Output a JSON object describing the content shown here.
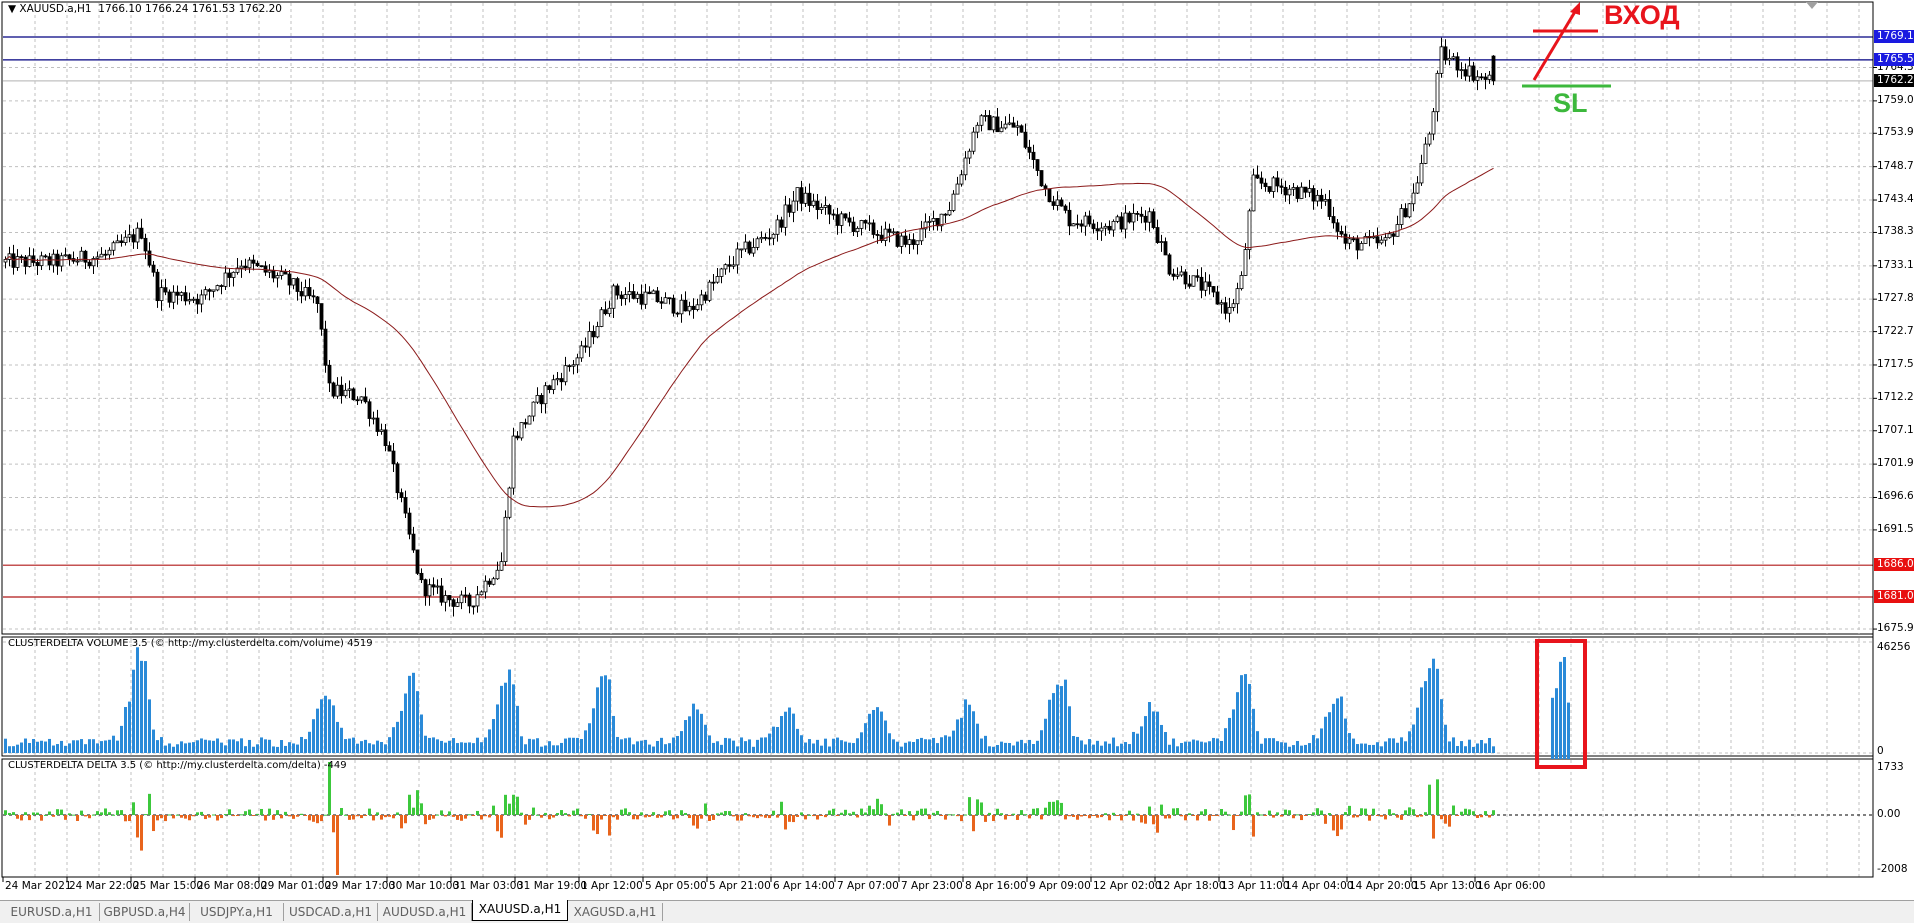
{
  "header": {
    "symbol": "XAUUSD.a,H1",
    "ohlc": "1766.10 1766.24 1761.53 1762.20"
  },
  "price_axis": {
    "ticks": [
      "1764.30",
      "1759.05",
      "1753.95",
      "1748.70",
      "1743.45",
      "1738.35",
      "1733.10",
      "1727.85",
      "1722.75",
      "1717.50",
      "1712.25",
      "1707.15",
      "1701.90",
      "1696.65",
      "1691.55",
      "1675.95"
    ],
    "tags": [
      {
        "label": "1769.10",
        "color": "#1a1ae0",
        "line": "#000080"
      },
      {
        "label": "1765.50",
        "color": "#1a1ae0",
        "line": "#000080"
      },
      {
        "label": "1762.20",
        "color": "#000000",
        "line": "#c0c0c0"
      },
      {
        "label": "1686.00",
        "color": "#e81010",
        "line": "#b01818"
      },
      {
        "label": "1681.00",
        "color": "#e81010",
        "line": "#b01818"
      }
    ]
  },
  "volume_pane": {
    "label": "CLUSTERDELTA VOLUME 3.5 (© http://my.clusterdelta.com/volume) 4519",
    "max": "46256",
    "min": "0",
    "color": "#2a8ad8",
    "peaks": [
      [
        34,
        40000
      ],
      [
        81,
        25000
      ],
      [
        102,
        30000
      ],
      [
        126,
        33000
      ],
      [
        150,
        30000
      ],
      [
        173,
        17000
      ],
      [
        196,
        16000
      ],
      [
        218,
        18000
      ],
      [
        241,
        21000
      ],
      [
        264,
        30000
      ],
      [
        287,
        17000
      ],
      [
        310,
        31000
      ],
      [
        333,
        21000
      ],
      [
        357,
        44000
      ]
    ],
    "highlighted_bars": [
      23000,
      27000,
      38000,
      40000,
      21000
    ]
  },
  "delta_pane": {
    "label": "CLUSTERDELTA DELTA 3.5 (© http://my.clusterdelta.com/delta) -449",
    "max": "1733",
    "zero": "0.00",
    "min": "-2008",
    "pos_color": "#3cc83c",
    "neg_color": "#e8641c"
  },
  "time_axis": [
    "24 Mar 2021",
    "24 Mar 22:00",
    "25 Mar 15:00",
    "26 Mar 08:00",
    "29 Mar 01:00",
    "29 Mar 17:00",
    "30 Mar 10:00",
    "31 Mar 03:00",
    "31 Mar 19:00",
    "1 Apr 12:00",
    "5 Apr 05:00",
    "5 Apr 21:00",
    "6 Apr 14:00",
    "7 Apr 07:00",
    "7 Apr 23:00",
    "8 Apr 16:00",
    "9 Apr 09:00",
    "12 Apr 02:00",
    "12 Apr 18:00",
    "13 Apr 11:00",
    "14 Apr 04:00",
    "14 Apr 20:00",
    "15 Apr 13:00",
    "16 Apr 06:00"
  ],
  "tabs": [
    {
      "label": "EURUSD.a,H1",
      "active": false
    },
    {
      "label": "GBPUSD.a,H4",
      "active": false
    },
    {
      "label": "USDJPY.a,H1",
      "active": false
    },
    {
      "label": "USDCAD.a,H1",
      "active": false
    },
    {
      "label": "AUDUSD.a,H1",
      "active": false
    },
    {
      "label": "XAUUSD.a,H1",
      "active": true
    },
    {
      "label": "XAGUSD.a,H1",
      "active": false
    }
  ],
  "annotations": {
    "entry": "ВХОД",
    "stop_loss": "SL",
    "entry_color": "#e8141c",
    "sl_color": "#3cb83c"
  },
  "chart_data": {
    "type": "candlestick",
    "timeframe": "H1",
    "last_bar": {
      "open": 1766.1,
      "high": 1766.24,
      "low": 1761.53,
      "close": 1762.2
    },
    "ma_color": "#8b1a1a",
    "price_path": [
      [
        0,
        1733.7
      ],
      [
        12,
        1733.7
      ],
      [
        25,
        1734.7
      ],
      [
        34,
        1738.5
      ],
      [
        38,
        1728.9
      ],
      [
        49,
        1728
      ],
      [
        59,
        1733.7
      ],
      [
        70,
        1730.8
      ],
      [
        78,
        1727
      ],
      [
        81,
        1713.5
      ],
      [
        89,
        1712.5
      ],
      [
        95,
        1705.8
      ],
      [
        101,
        1690.4
      ],
      [
        104,
        1682.8
      ],
      [
        110,
        1680.8
      ],
      [
        116,
        1679.9
      ],
      [
        124,
        1686.6
      ],
      [
        127,
        1705.8
      ],
      [
        135,
        1713.5
      ],
      [
        144,
        1719.3
      ],
      [
        152,
        1728.9
      ],
      [
        162,
        1728
      ],
      [
        171,
        1726
      ],
      [
        183,
        1734.7
      ],
      [
        192,
        1738.5
      ],
      [
        198,
        1744.3
      ],
      [
        208,
        1740.4
      ],
      [
        217,
        1738.5
      ],
      [
        226,
        1736.6
      ],
      [
        236,
        1742.4
      ],
      [
        243,
        1755.8
      ],
      [
        253,
        1754.9
      ],
      [
        260,
        1745.3
      ],
      [
        266,
        1740.4
      ],
      [
        276,
        1739.5
      ],
      [
        286,
        1741.4
      ],
      [
        291,
        1732.8
      ],
      [
        299,
        1729.9
      ],
      [
        306,
        1726
      ],
      [
        309,
        1730.8
      ],
      [
        312,
        1746.2
      ],
      [
        321,
        1745.3
      ],
      [
        330,
        1743.3
      ],
      [
        335,
        1736.6
      ],
      [
        345,
        1736.6
      ],
      [
        352,
        1744.3
      ],
      [
        356,
        1753.9
      ],
      [
        359,
        1766.4
      ],
      [
        364,
        1764.5
      ],
      [
        369,
        1762.6
      ],
      [
        372,
        1762.2
      ]
    ]
  }
}
